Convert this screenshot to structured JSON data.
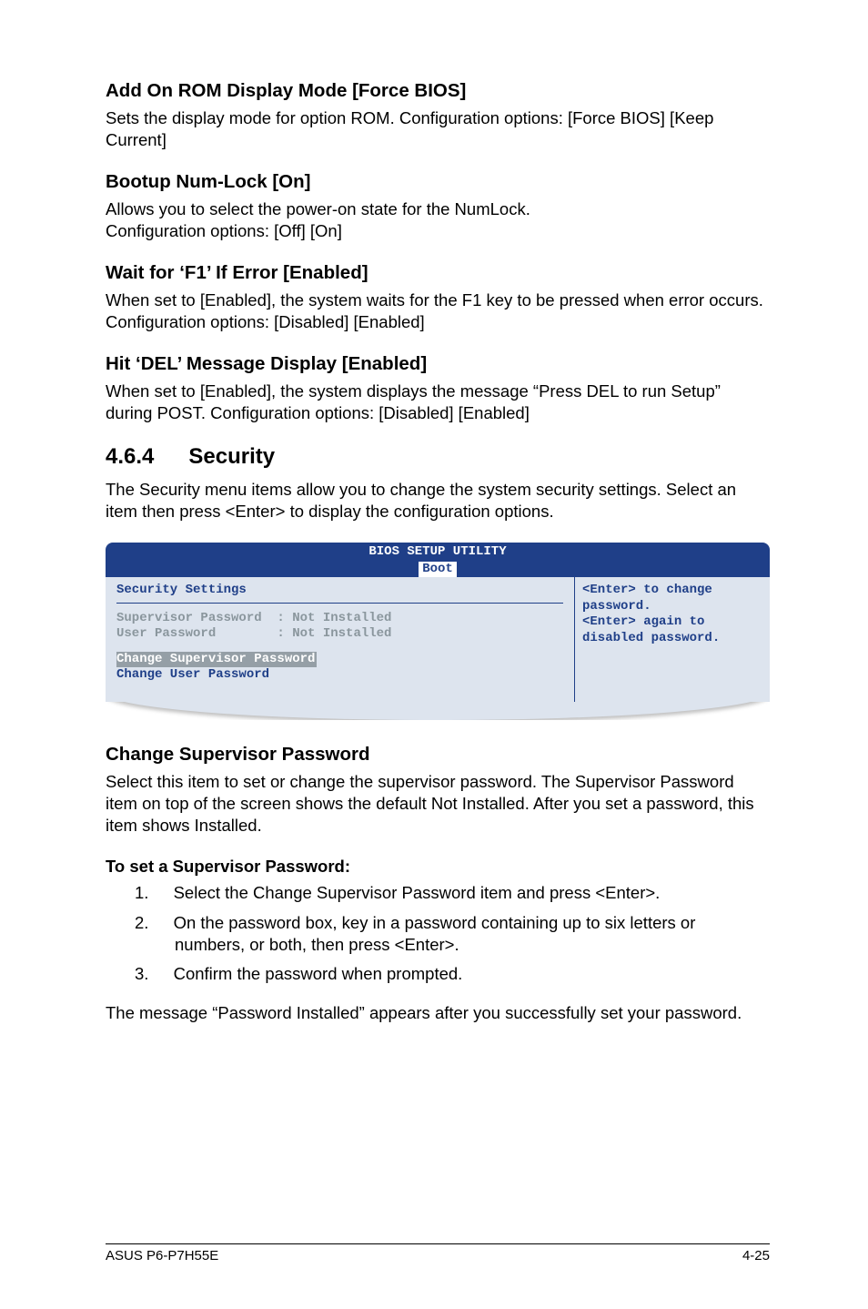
{
  "sec1": {
    "title": "Add On ROM Display Mode [Force BIOS]",
    "body": "Sets the display mode for option ROM. Configuration options: [Force BIOS] [Keep Current]"
  },
  "sec2": {
    "title": "Bootup Num-Lock [On]",
    "body_l1": "Allows you to select the power-on state for the NumLock.",
    "body_l2": "Configuration options: [Off] [On]"
  },
  "sec3": {
    "title": "Wait for ‘F1’ If Error [Enabled]",
    "body": "When set to [Enabled], the system waits for the F1 key to be pressed when error occurs. Configuration options: [Disabled] [Enabled]"
  },
  "sec4": {
    "title": "Hit ‘DEL’ Message Display [Enabled]",
    "body": "When set to [Enabled], the system displays the message “Press DEL to run Setup” during POST. Configuration options: [Disabled] [Enabled]"
  },
  "section464": {
    "num": "4.6.4",
    "title": "Security",
    "intro": "The Security menu items allow you to change the system security settings. Select an item then press <Enter> to display the configuration options."
  },
  "bios": {
    "title": "BIOS SETUP UTILITY",
    "tab": "Boot",
    "heading": "Security Settings",
    "row1": "Supervisor Password  : Not Installed",
    "row2": "User Password        : Not Installed",
    "sel": "Change Supervisor Password",
    "link": "Change User Password",
    "help1": "<Enter> to change password.",
    "help2": "<Enter> again to disabled password."
  },
  "csp": {
    "title": "Change Supervisor Password",
    "body": "Select this item to set or change the supervisor password. The Supervisor Password item on top of the screen shows the default Not Installed. After you set a password, this item shows Installed.",
    "sub": "To set a Supervisor Password:",
    "step1": "Select the Change Supervisor Password item and press <Enter>.",
    "step2": "On the password box, key in a password containing up to six letters or numbers, or both, then press <Enter>.",
    "step3": "Confirm the password when prompted.",
    "tail": "The message “Password Installed” appears after you successfully set your password."
  },
  "footer": {
    "left": "ASUS P6-P7H55E",
    "right": "4-25"
  }
}
